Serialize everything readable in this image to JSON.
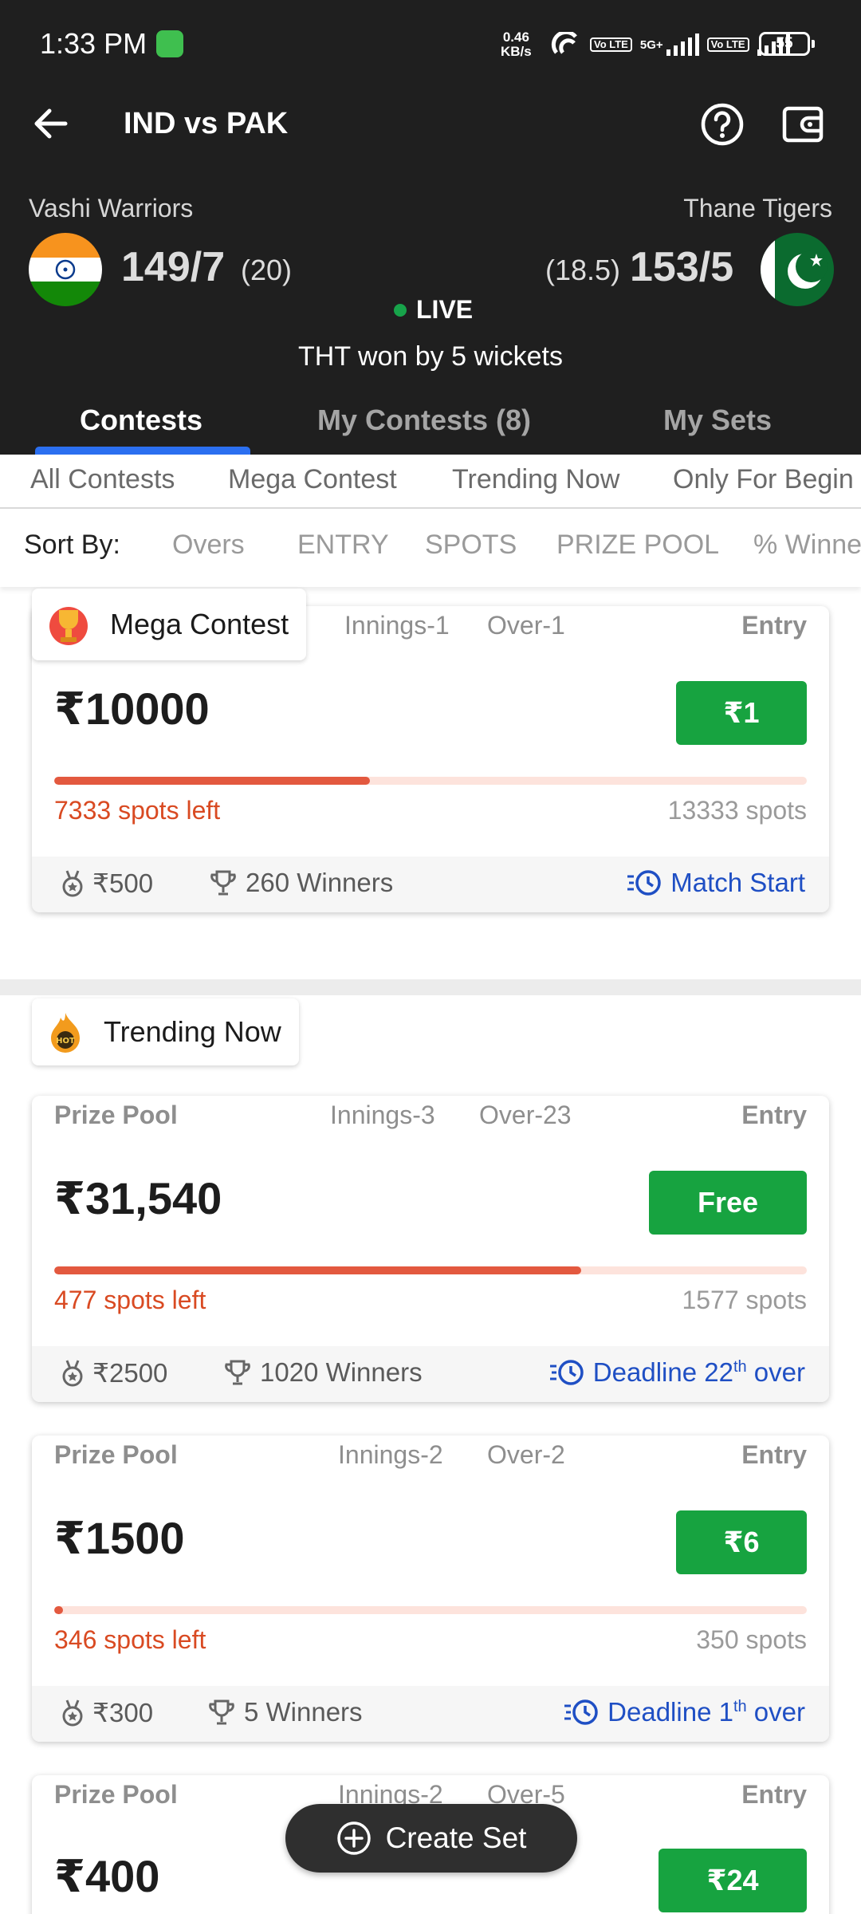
{
  "status_bar": {
    "time": "1:33 PM",
    "speed_value": "0.46",
    "speed_unit": "KB/s",
    "network_tag": "5G+",
    "volte_label": "Vo LTE",
    "battery": "55"
  },
  "top_bar": {
    "title": "IND vs PAK",
    "icons": [
      "back-arrow-icon",
      "help-icon",
      "wallet-icon"
    ]
  },
  "match": {
    "team_a": {
      "name": "Vashi Warriors",
      "score": "149/7",
      "overs": "(20)"
    },
    "team_b": {
      "name": "Thane Tigers",
      "score": "153/5",
      "overs": "(18.5)"
    },
    "live_label": "LIVE",
    "result": "THT won by 5 wickets"
  },
  "tabs": [
    {
      "label": "Contests"
    },
    {
      "label": "My Contests (8)"
    },
    {
      "label": "My Sets"
    }
  ],
  "filters": [
    "All Contests",
    "Mega Contest",
    "Trending Now",
    "Only For Begin"
  ],
  "sort": {
    "label": "Sort By:",
    "options": [
      "Overs",
      "ENTRY",
      "SPOTS",
      "PRIZE POOL",
      "% Winne"
    ]
  },
  "sections": {
    "mega": "Mega Contest",
    "trending": "Trending Now"
  },
  "cards": [
    {
      "innings": "Innings-1",
      "over": "Over-1",
      "entry_label": "Entry",
      "prize": "₹10000",
      "entry_fee": "₹1",
      "fill": 0.42,
      "spots_left": "7333 spots left",
      "spots_total": "13333 spots",
      "first_prize": "₹500",
      "winners": "260 Winners",
      "timing": "Match Start",
      "timing_sup": ""
    },
    {
      "pp_label": "Prize Pool",
      "innings": "Innings-3",
      "over": "Over-23",
      "entry_label": "Entry",
      "prize": "₹31,540",
      "entry_fee": "Free",
      "fill": 0.7,
      "spots_left": "477 spots left",
      "spots_total": "1577 spots",
      "first_prize": "₹2500",
      "winners": "1020 Winners",
      "timing": "Deadline 22",
      "timing_sup": "th",
      "timing_end": "over"
    },
    {
      "pp_label": "Prize Pool",
      "innings": "Innings-2",
      "over": "Over-2",
      "entry_label": "Entry",
      "prize": "₹1500",
      "entry_fee": "₹6",
      "fill": 0.01,
      "spots_left": "346 spots left",
      "spots_total": "350 spots",
      "first_prize": "₹300",
      "winners": "5 Winners",
      "timing": "Deadline 1",
      "timing_sup": "th",
      "timing_end": "over"
    },
    {
      "pp_label": "Prize Pool",
      "innings": "Innings-2",
      "over": "Over-5",
      "entry_label": "Entry",
      "prize": "₹400",
      "entry_fee": "₹24"
    }
  ],
  "create_set": {
    "label": "Create Set",
    "icon": "plus-circle-icon"
  },
  "colors": {
    "header_bg": "#1f1f1f",
    "tab_indicator": "#2b6ff0",
    "entry_green": "#17a340",
    "progress_red": "#e3593f",
    "spots_red": "#d94a22",
    "timing_blue": "#1f4fc4"
  }
}
